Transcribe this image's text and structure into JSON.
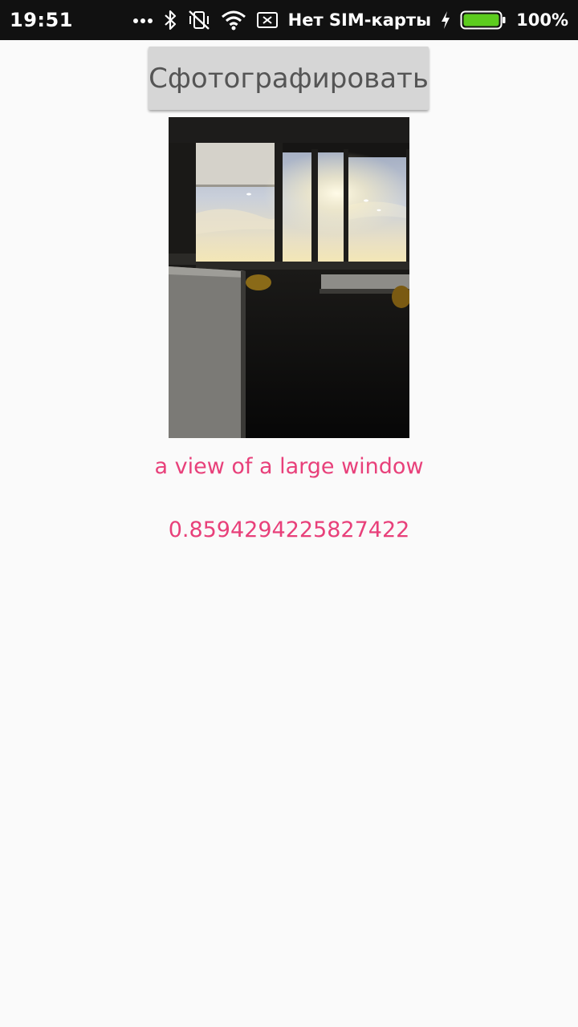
{
  "status_bar": {
    "time": "19:51",
    "more_dots": "•••",
    "carrier": "Нет SIM-карты",
    "battery_percent": "100%",
    "battery_level": 1.0,
    "icons": [
      "more-dots-icon",
      "bluetooth-icon",
      "vibrate-off-icon",
      "wifi-icon",
      "no-sim-icon",
      "charging-icon",
      "battery-icon"
    ],
    "battery_color": "#5ccc1e"
  },
  "main": {
    "capture_button_label": "Сфотографировать",
    "caption_text": "a view of a large window",
    "confidence_text": "0.8594294225827422"
  },
  "colors": {
    "accent": "#e8407a",
    "background": "#fafafa",
    "button_bg": "#d6d6d6",
    "status_bar_bg": "#111111"
  }
}
